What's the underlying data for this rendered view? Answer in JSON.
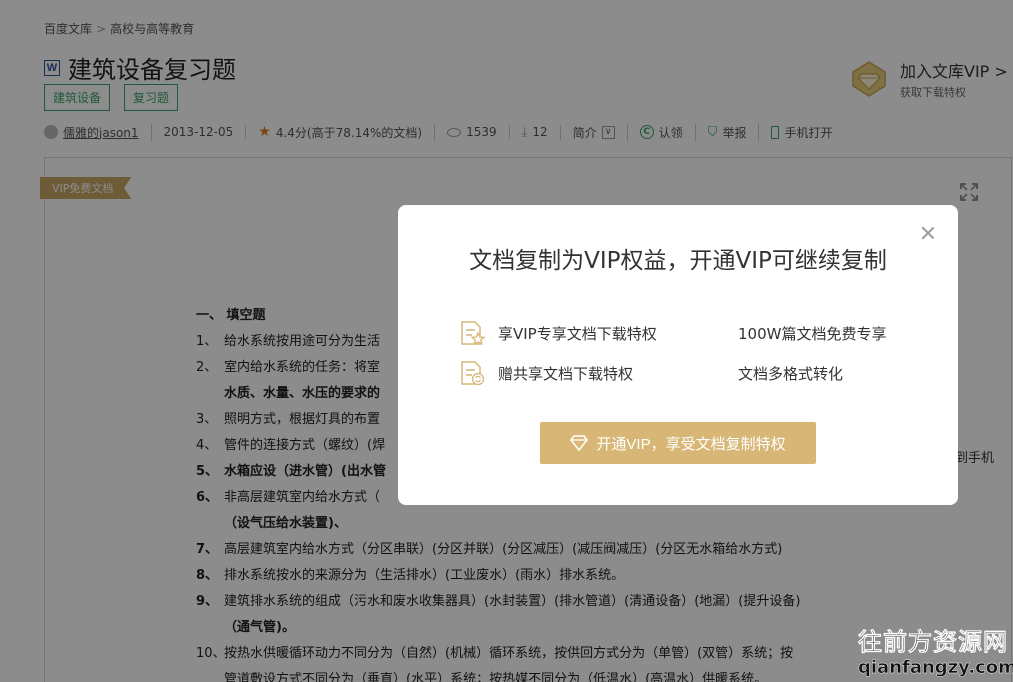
{
  "breadcrumb": {
    "home": "百度文库",
    "sep": ">",
    "category": "高校与高等教育"
  },
  "document": {
    "type_icon": "W",
    "title": "建筑设备复习题",
    "tags": [
      "建筑设备",
      "复习题"
    ]
  },
  "vip_promo": {
    "icon": "diamond-icon",
    "title": "加入文库VIP >",
    "subtitle": "获取下载特权"
  },
  "meta": {
    "author": "儒雅的jason1",
    "date": "2013-12-05",
    "rating": "4.4分(高于78.14%的文档)",
    "views": "1539",
    "downloads": "12",
    "intro": "简介",
    "intro_toggle": "∨",
    "claim": "认领",
    "report": "举报",
    "mobile": "手机打开"
  },
  "viewer": {
    "ribbon": "VIP免费文档",
    "side_phone": "到手机"
  },
  "content": {
    "section": "一、   填空题",
    "lines": [
      {
        "num": "1、",
        "text": "给水系统按用途可分为生活"
      },
      {
        "num": "2、",
        "text": "室内给水系统的任务：将室"
      },
      {
        "num": "",
        "text": "水质、水量、水压的要求的"
      },
      {
        "num": "3、",
        "text": "照明方式，根据灯具的布置"
      },
      {
        "num": "4、",
        "text": "管件的连接方式（螺纹）(焊"
      },
      {
        "num": "5、",
        "text": "水箱应设（进水管）(出水管"
      },
      {
        "num": "6、",
        "text": "非高层建筑室内给水方式（"
      },
      {
        "num": "",
        "text": "（设气压给水装置)、"
      },
      {
        "num": "7、",
        "text": "高层建筑室内给水方式（分区串联）(分区并联）(分区减压）(减压阀减压）(分区无水箱给水方式)"
      },
      {
        "num": "8、",
        "text": "排水系统按水的来源分为（生活排水）(工业废水）(雨水）排水系统。"
      },
      {
        "num": "9、",
        "text": "建筑排水系统的组成（污水和废水收集器具）(水封装置）(排水管道）(清通设备）(地漏）(提升设备)"
      },
      {
        "num": "",
        "text": "（通气管)。"
      },
      {
        "num": "10、",
        "text": "按热水供暖循环动力不同分为（自然）(机械）循环系统，按供回方式分为（单管）(双管）系统；按"
      },
      {
        "num": "",
        "text": "管道敷设方式不同分为（垂直）(水平）系统；按热媒不同分为（低温水）(高温水）供暖系统。"
      }
    ]
  },
  "modal": {
    "title": "文档复制为VIP权益，开通VIP可继续复制",
    "benefits": [
      {
        "left": "享VIP专享文档下载特权",
        "right": "100W篇文档免费专享"
      },
      {
        "left": "赠共享文档下载特权",
        "right": "文档多格式转化"
      }
    ],
    "cta": "开通VIP，享受文档复制特权"
  },
  "watermark": {
    "line1": "往前方资源网",
    "line2": "qianfangzy.com"
  },
  "colors": {
    "accent_green": "#3aa56b",
    "vip_gold": "#d8b776",
    "overlay": "rgba(0,0,0,0.45)"
  }
}
